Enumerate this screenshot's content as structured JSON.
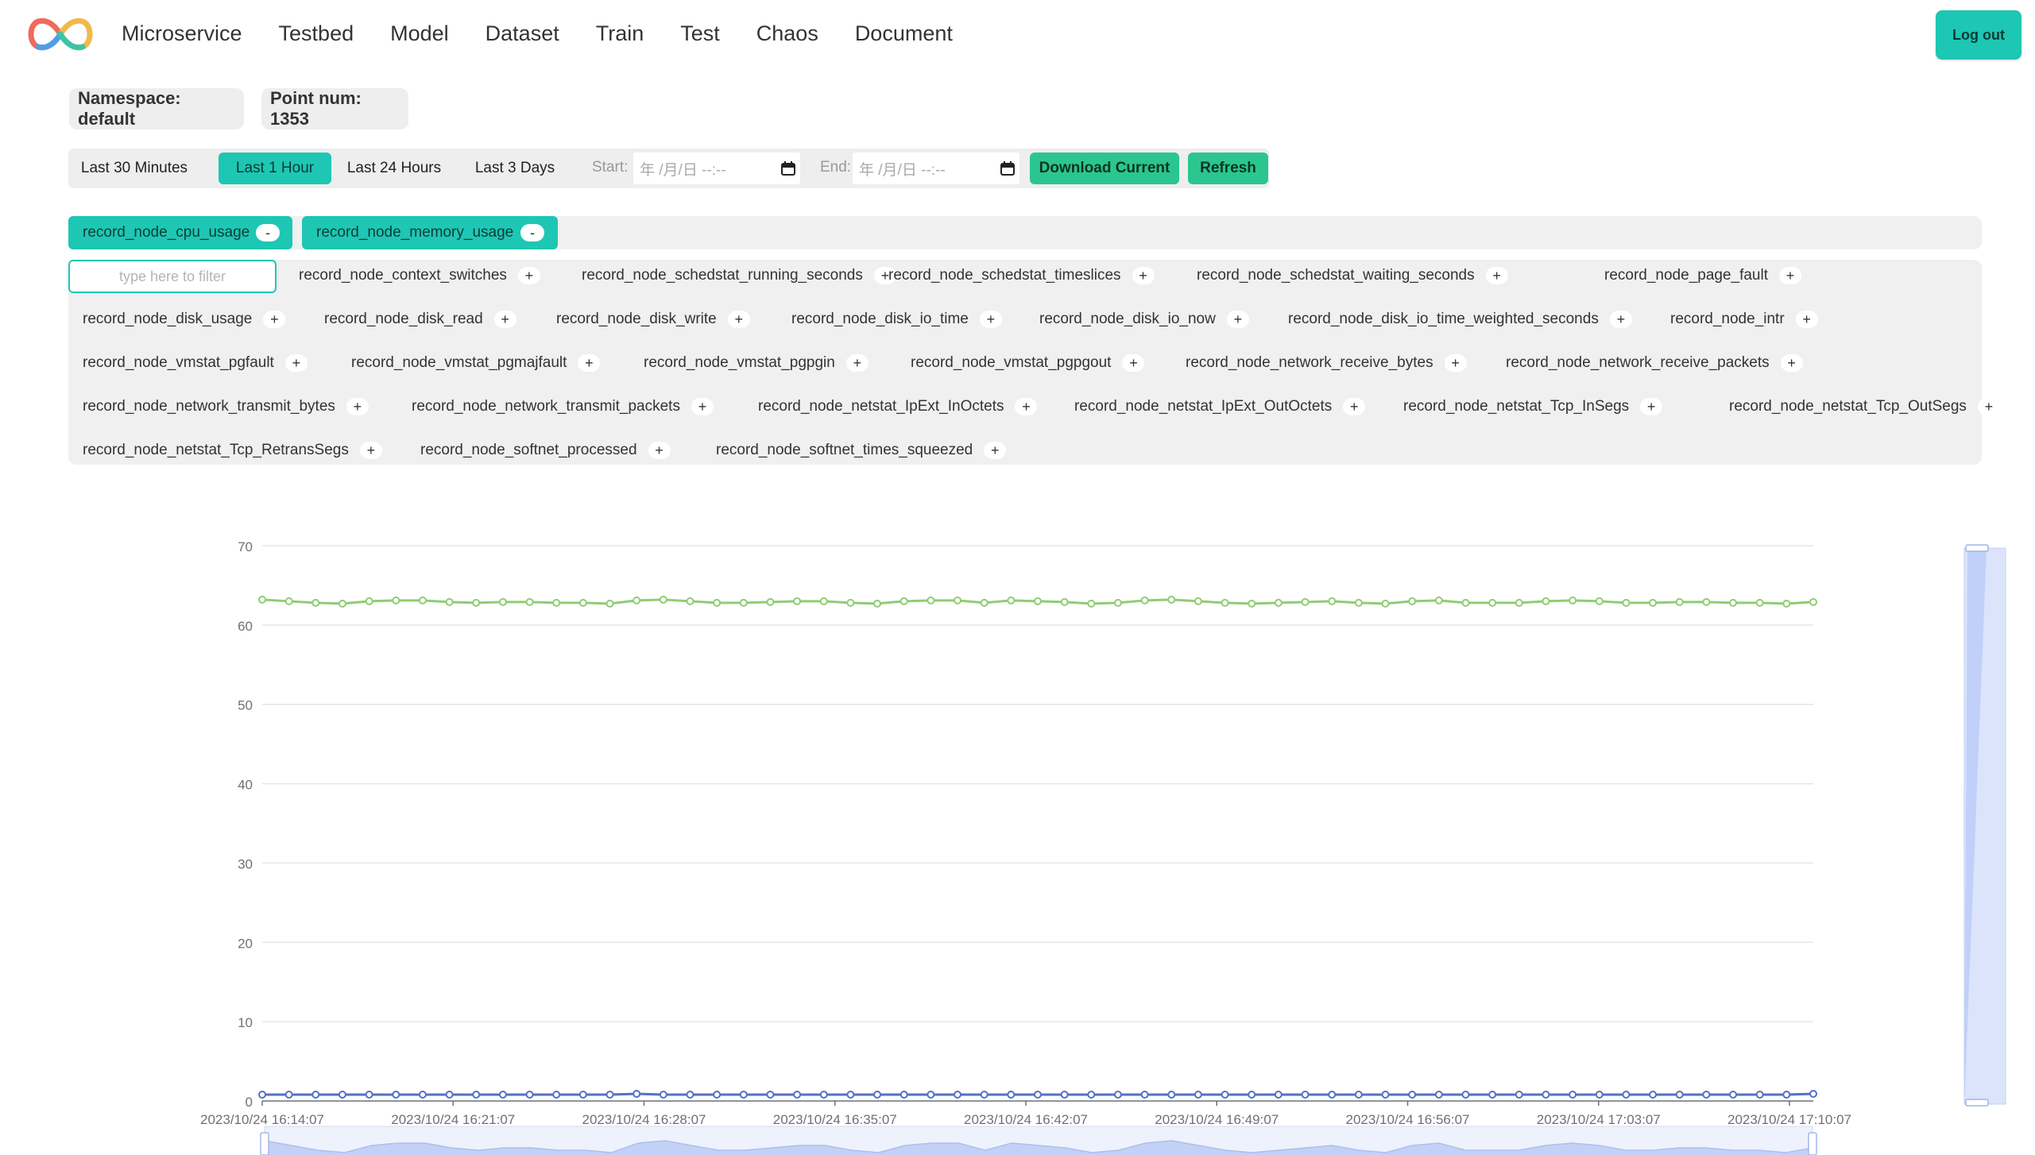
{
  "nav": {
    "items": [
      "Microservice",
      "Testbed",
      "Model",
      "Dataset",
      "Train",
      "Test",
      "Chaos",
      "Document"
    ],
    "logout": "Log out"
  },
  "info": {
    "namespace": "Namespace: default",
    "points": "Point num: 1353"
  },
  "range": {
    "options": [
      "Last 30 Minutes",
      "Last 1 Hour",
      "Last 24 Hours",
      "Last 3 Days"
    ],
    "active": "Last 1 Hour",
    "start_label": "Start:",
    "end_label": "End:",
    "date_placeholder": "年 /月/日 --:--",
    "download": "Download Current",
    "refresh": "Refresh"
  },
  "selected": {
    "metrics": [
      "record_node_cpu_usage",
      "record_node_memory_usage"
    ],
    "remove": "-"
  },
  "available": {
    "filter_placeholder": "type here to filter",
    "add": "+",
    "rows": [
      [
        "record_node_context_switches",
        "record_node_schedstat_running_seconds",
        "record_node_schedstat_timeslices",
        "record_node_schedstat_waiting_seconds",
        "record_node_page_fault"
      ],
      [
        "record_node_disk_usage",
        "record_node_disk_read",
        "record_node_disk_write",
        "record_node_disk_io_time",
        "record_node_disk_io_now",
        "record_node_disk_io_time_weighted_seconds",
        "record_node_intr"
      ],
      [
        "record_node_vmstat_pgfault",
        "record_node_vmstat_pgmajfault",
        "record_node_vmstat_pgpgin",
        "record_node_vmstat_pgpgout",
        "record_node_network_receive_bytes",
        "record_node_network_receive_packets"
      ],
      [
        "record_node_network_transmit_bytes",
        "record_node_network_transmit_packets",
        "record_node_netstat_IpExt_InOctets",
        "record_node_netstat_IpExt_OutOctets",
        "record_node_netstat_Tcp_InSegs",
        "record_node_netstat_Tcp_OutSegs"
      ],
      [
        "record_node_netstat_Tcp_RetransSegs",
        "record_node_softnet_processed",
        "record_node_softnet_times_squeezed"
      ]
    ]
  },
  "chart_data": {
    "type": "line",
    "ylim": [
      0,
      70
    ],
    "yticks": [
      0,
      10,
      20,
      30,
      40,
      50,
      60,
      70
    ],
    "xtick_labels": [
      "2023/10/24 16:14:07",
      "2023/10/24 16:21:07",
      "2023/10/24 16:28:07",
      "2023/10/24 16:35:07",
      "2023/10/24 16:42:07",
      "2023/10/24 16:49:07",
      "2023/10/24 16:56:07",
      "2023/10/24 17:03:07",
      "2023/10/24 17:10:07"
    ],
    "colors": {
      "upper": "#91cc75",
      "lower": "#5470c6",
      "zoom": "#b9c9f7"
    },
    "series": [
      {
        "values": [
          63.2,
          63.0,
          62.8,
          62.7,
          63.0,
          63.1,
          63.1,
          62.9,
          62.8,
          62.9,
          62.9,
          62.8,
          62.8,
          62.7,
          63.1,
          63.2,
          63.0,
          62.8,
          62.8,
          62.9,
          63.0,
          63.0,
          62.8,
          62.7,
          63.0,
          63.1,
          63.1,
          62.8,
          63.1,
          63.0,
          62.9,
          62.7,
          62.8,
          63.1,
          63.2,
          63.0,
          62.8,
          62.7,
          62.8,
          62.9,
          63.0,
          62.8,
          62.7,
          63.0,
          63.1,
          62.8,
          62.8,
          62.8,
          63.0,
          63.1,
          63.0,
          62.8,
          62.8,
          62.9,
          62.9,
          62.8,
          62.8,
          62.7,
          62.9
        ]
      },
      {
        "values": [
          0.8,
          0.8,
          0.8,
          0.8,
          0.8,
          0.8,
          0.8,
          0.8,
          0.8,
          0.8,
          0.8,
          0.8,
          0.8,
          0.8,
          0.9,
          0.8,
          0.8,
          0.8,
          0.8,
          0.8,
          0.8,
          0.8,
          0.8,
          0.8,
          0.8,
          0.8,
          0.8,
          0.8,
          0.8,
          0.8,
          0.8,
          0.8,
          0.8,
          0.8,
          0.8,
          0.8,
          0.8,
          0.8,
          0.8,
          0.8,
          0.8,
          0.8,
          0.8,
          0.8,
          0.8,
          0.8,
          0.8,
          0.8,
          0.8,
          0.8,
          0.8,
          0.8,
          0.8,
          0.8,
          0.8,
          0.8,
          0.8,
          0.8,
          0.9
        ]
      }
    ]
  }
}
